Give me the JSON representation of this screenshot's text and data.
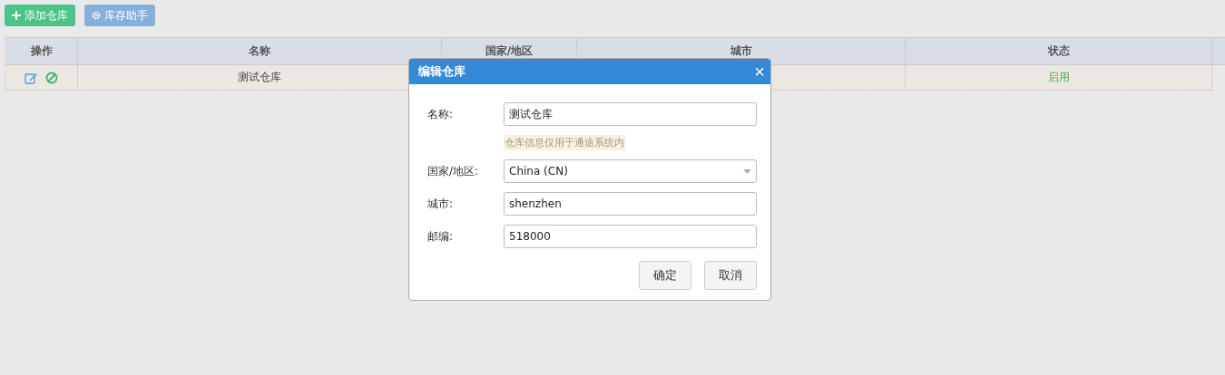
{
  "toolbar": [
    {
      "label": "添加仓库",
      "kind": "add"
    },
    {
      "label": "库存助手",
      "kind": "helper"
    }
  ],
  "table": {
    "columns": [
      "操作",
      "名称",
      "国家/地区",
      "城市",
      "状态"
    ],
    "rows": [
      {
        "name": "测试仓库",
        "status": "启用",
        "enabled": true
      }
    ]
  },
  "dialog": {
    "title": "编辑仓库",
    "close": "×",
    "fields": [
      {
        "label": "名称:",
        "value": "测试仓库",
        "kind": "text",
        "hint": "仓库信息仅用于通途系统内"
      },
      {
        "label": "国家/地区:",
        "value": "China (CN)",
        "kind": "select"
      },
      {
        "label": "城市:",
        "value": "shenzhen",
        "kind": "text"
      },
      {
        "label": "邮编:",
        "value": "518000",
        "kind": "text"
      }
    ],
    "buttons": [
      "确定",
      "取消"
    ]
  }
}
